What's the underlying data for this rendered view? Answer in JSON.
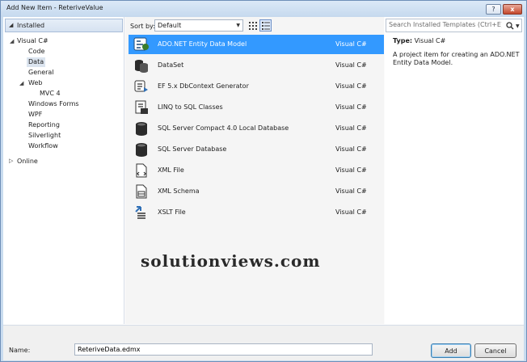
{
  "window": {
    "title": "Add New Item - ReteriveValue",
    "help_label": "?",
    "close_label": "x"
  },
  "left_pane": {
    "installed_label": "Installed",
    "tree": [
      {
        "label": "Visual C#",
        "expanded": true
      },
      {
        "label": "Code"
      },
      {
        "label": "Data",
        "selected": true
      },
      {
        "label": "General"
      },
      {
        "label": "Web",
        "expanded": true
      },
      {
        "label": "MVC 4"
      },
      {
        "label": "Windows Forms"
      },
      {
        "label": "WPF"
      },
      {
        "label": "Reporting"
      },
      {
        "label": "Silverlight"
      },
      {
        "label": "Workflow"
      },
      {
        "label": "Online",
        "expanded": false
      }
    ]
  },
  "toolbar": {
    "sort_label": "Sort by:",
    "sort_value": "Default",
    "grid_view_icon": "grid-view-icon",
    "list_view_icon": "list-view-icon"
  },
  "templates": [
    {
      "name": "ADO.NET Entity Data Model",
      "lang": "Visual C#",
      "icon": "entity-model-icon",
      "selected": true
    },
    {
      "name": "DataSet",
      "lang": "Visual C#",
      "icon": "dataset-icon"
    },
    {
      "name": "EF 5.x DbContext Generator",
      "lang": "Visual C#",
      "icon": "dbcontext-generator-icon"
    },
    {
      "name": "LINQ to SQL Classes",
      "lang": "Visual C#",
      "icon": "linq-to-sql-icon"
    },
    {
      "name": "SQL Server Compact 4.0 Local Database",
      "lang": "Visual C#",
      "icon": "database-icon"
    },
    {
      "name": "SQL Server Database",
      "lang": "Visual C#",
      "icon": "database-icon"
    },
    {
      "name": "XML File",
      "lang": "Visual C#",
      "icon": "xml-file-icon"
    },
    {
      "name": "XML Schema",
      "lang": "Visual C#",
      "icon": "xml-schema-icon"
    },
    {
      "name": "XSLT File",
      "lang": "Visual C#",
      "icon": "xslt-file-icon"
    }
  ],
  "watermark": "solutionviews.com",
  "details": {
    "search_placeholder": "Search Installed Templates (Ctrl+E)",
    "type_label": "Type:",
    "type_value": "Visual C#",
    "description": "A project item for creating an ADO.NET Entity Data Model."
  },
  "bottom": {
    "name_label": "Name:",
    "name_value": "ReteriveData.edmx",
    "add_label": "Add",
    "cancel_label": "Cancel"
  },
  "colors": {
    "selection": "#3399ff",
    "title_bar": "#c5d9ee",
    "close_button": "#c4482c"
  }
}
